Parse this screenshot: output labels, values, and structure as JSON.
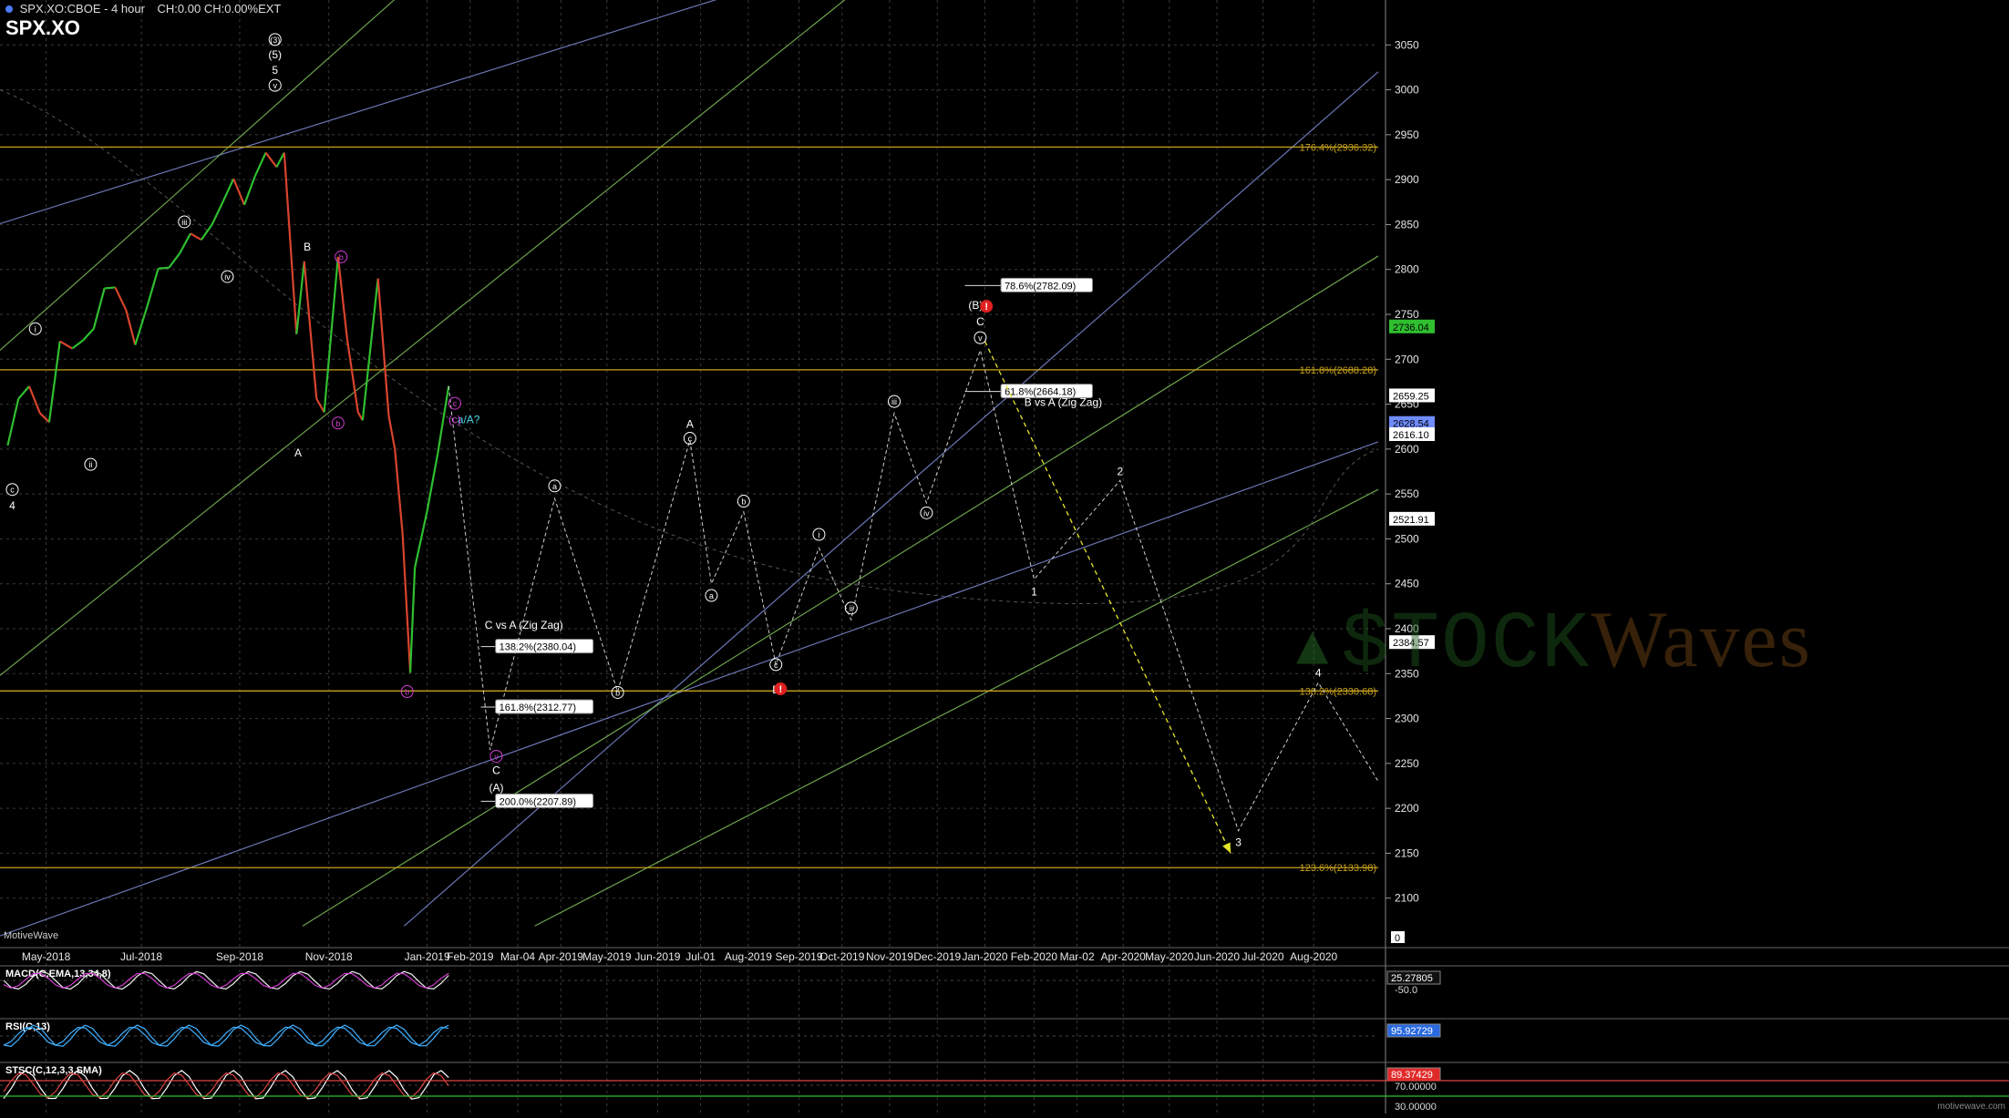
{
  "header": {
    "title": "SPX.XO:CBOE - 4 hour",
    "stats": "CH:0.00 CH:0.00%EXT",
    "symbol": "SPX.XO"
  },
  "brand": "MotiveWave",
  "watermark": {
    "part1": "$TOCK",
    "part2": "Waves"
  },
  "credit": "motivewave.com",
  "colors": {
    "grid": "#3a3a3a",
    "fib": "#c8a21a",
    "channel_blue": "#7f8cd6",
    "channel_green": "#7ebf5a",
    "projection": "#cfcfcf",
    "price_up": "#2fbf2f",
    "price_down": "#d9442c",
    "wave_magenta": "#d33bd3",
    "arrow_yellow": "#e6e62a"
  },
  "chart_data": {
    "type": "line",
    "title": "",
    "xlabel": "",
    "ylabel": "",
    "ylim": [
      2050,
      3100
    ],
    "x_ticks": [
      "May-2018",
      "Jul-2018",
      "Sep-2018",
      "Nov-2018",
      "Jan-2019",
      "Feb-2019",
      "Mar-04",
      "Apr-2019",
      "May-2019",
      "Jun-2019",
      "Jul-01",
      "Aug-2019",
      "Sep-2019",
      "Oct-2019",
      "Nov-2019",
      "Dec-2019",
      "Jan-2020",
      "Feb-2020",
      "Mar-02",
      "Apr-2020",
      "May-2020",
      "Jun-2020",
      "Jul-2020",
      "Aug-2020"
    ],
    "y_ticks": [
      2100,
      2150,
      2200,
      2250,
      2300,
      2350,
      2400,
      2450,
      2500,
      2550,
      2600,
      2650,
      2700,
      2750,
      2800,
      2850,
      2900,
      2950,
      3000,
      3050
    ],
    "grid": true,
    "series": [
      {
        "name": "SPX.XO",
        "kind": "price",
        "points": [
          [
            "2018-04-06",
            2604
          ],
          [
            "2018-04-13",
            2656
          ],
          [
            "2018-04-20",
            2670
          ],
          [
            "2018-04-27",
            2640
          ],
          [
            "2018-05-03",
            2630
          ],
          [
            "2018-05-10",
            2720
          ],
          [
            "2018-05-18",
            2712
          ],
          [
            "2018-05-25",
            2721
          ],
          [
            "2018-06-01",
            2734
          ],
          [
            "2018-06-08",
            2779
          ],
          [
            "2018-06-15",
            2780
          ],
          [
            "2018-06-22",
            2755
          ],
          [
            "2018-06-28",
            2716
          ],
          [
            "2018-07-06",
            2760
          ],
          [
            "2018-07-13",
            2801
          ],
          [
            "2018-07-20",
            2802
          ],
          [
            "2018-07-27",
            2818
          ],
          [
            "2018-08-03",
            2840
          ],
          [
            "2018-08-10",
            2833
          ],
          [
            "2018-08-17",
            2850
          ],
          [
            "2018-08-24",
            2875
          ],
          [
            "2018-08-31",
            2901
          ],
          [
            "2018-09-07",
            2872
          ],
          [
            "2018-09-14",
            2904
          ],
          [
            "2018-09-21",
            2930
          ],
          [
            "2018-09-28",
            2914
          ],
          [
            "2018-10-03",
            2930
          ],
          [
            "2018-10-11",
            2728
          ],
          [
            "2018-10-16",
            2809
          ],
          [
            "2018-10-24",
            2656
          ],
          [
            "2018-10-29",
            2641
          ],
          [
            "2018-11-07",
            2814
          ],
          [
            "2018-11-13",
            2722
          ],
          [
            "2018-11-20",
            2641
          ],
          [
            "2018-11-23",
            2632
          ],
          [
            "2018-12-03",
            2790
          ],
          [
            "2018-12-10",
            2637
          ],
          [
            "2018-12-14",
            2600
          ],
          [
            "2018-12-19",
            2506
          ],
          [
            "2018-12-24",
            2351
          ],
          [
            "2018-12-27",
            2468
          ],
          [
            "2019-01-04",
            2531
          ],
          [
            "2019-01-11",
            2596
          ],
          [
            "2019-01-18",
            2670
          ]
        ]
      },
      {
        "name": "",
        "kind": "projection",
        "points": [
          [
            "2019-01-18",
            2670
          ],
          [
            "2019-02-14",
            2265
          ],
          [
            "2019-03-28",
            2545
          ],
          [
            "2019-05-08",
            2330
          ],
          [
            "2019-06-24",
            2610
          ],
          [
            "2019-07-08",
            2450
          ],
          [
            "2019-07-29",
            2530
          ],
          [
            "2019-08-19",
            2360
          ],
          [
            "2019-09-16",
            2490
          ],
          [
            "2019-10-07",
            2410
          ],
          [
            "2019-11-04",
            2640
          ],
          [
            "2019-11-25",
            2540
          ],
          [
            "2019-12-30",
            2710
          ],
          [
            "2020-02-03",
            2455
          ],
          [
            "2020-03-30",
            2565
          ],
          [
            "2020-06-15",
            2175
          ],
          [
            "2020-08-06",
            2340
          ],
          [
            "2020-09-14",
            2230
          ]
        ]
      },
      {
        "name": "",
        "kind": "arrow",
        "points": [
          [
            "2020-01-02",
            2720
          ],
          [
            "2020-06-10",
            2150
          ]
        ]
      }
    ],
    "fib_levels": [
      {
        "label": "176.4%(2936.32)",
        "value": 2936.32
      },
      {
        "label": "161.8%(2688.28)",
        "value": 2688.28
      },
      {
        "label": "138.2%(2330.68)",
        "value": 2330.68
      },
      {
        "label": "123.6%(2133.98)",
        "value": 2133.98
      }
    ],
    "fib_boxes": [
      {
        "label": "78.6%(2782.09)",
        "value": 2782.09,
        "x": "2019-12-20",
        "x_end": "2020-03-12"
      },
      {
        "label": "61.8%(2664.18)",
        "value": 2664.18,
        "x": "2019-12-20",
        "x_end": "2020-03-12"
      },
      {
        "label": "138.2%(2380.04)",
        "value": 2380.04,
        "x": "2019-02-08",
        "x_end": "2019-04-22"
      },
      {
        "label": "161.8%(2312.77)",
        "value": 2312.77,
        "x": "2019-02-08",
        "x_end": "2019-04-22"
      },
      {
        "label": "200.0%(2207.89)",
        "value": 2207.89,
        "x": "2019-02-08",
        "x_end": "2019-04-22"
      }
    ],
    "annotations": [
      {
        "text": "C vs A (Zig Zag)",
        "x": "2019-03-08",
        "y": 2400
      },
      {
        "text": "B vs A (Zig Zag)",
        "x": "2020-02-22",
        "y": 2648
      },
      {
        "text": "a/A?",
        "x": "2019-01-31",
        "y": 2629
      }
    ],
    "price_tags": [
      {
        "label": "2736.04",
        "value": 2736.04,
        "color": "#2fbf2f"
      },
      {
        "label": "2659.25",
        "value": 2659.25,
        "color": "#ffffff"
      },
      {
        "label": "2628.54",
        "value": 2628.54,
        "color": "#6f8cff"
      },
      {
        "label": "2616.10",
        "value": 2616.1,
        "color": "#ffffff"
      },
      {
        "label": "2521.91",
        "value": 2521.91,
        "color": "#ffffff"
      },
      {
        "label": "2384.57",
        "value": 2384.57,
        "color": "#ffffff"
      }
    ],
    "wave_labels": [
      {
        "text": "(3)",
        "x": "2018-09-27",
        "y": 3056,
        "style": "circle-white"
      },
      {
        "text": "(5)",
        "x": "2018-09-27",
        "y": 3039,
        "style": "plain"
      },
      {
        "text": "5",
        "x": "2018-09-27",
        "y": 3022,
        "style": "plain"
      },
      {
        "text": "v",
        "x": "2018-09-27",
        "y": 3005,
        "style": "circle-white"
      },
      {
        "text": "iii",
        "x": "2018-07-30",
        "y": 2853,
        "style": "circle-white"
      },
      {
        "text": "iv",
        "x": "2018-08-27",
        "y": 2792,
        "style": "circle-white"
      },
      {
        "text": "i",
        "x": "2018-04-24",
        "y": 2734,
        "style": "circle-white"
      },
      {
        "text": "ii",
        "x": "2018-05-30",
        "y": 2583,
        "style": "circle-white"
      },
      {
        "text": "c",
        "x": "2018-04-09",
        "y": 2555,
        "style": "circle-white"
      },
      {
        "text": "4",
        "x": "2018-04-09",
        "y": 2537,
        "style": "plain"
      },
      {
        "text": "B",
        "x": "2018-10-18",
        "y": 2825,
        "style": "plain"
      },
      {
        "text": "A",
        "x": "2018-10-12",
        "y": 2596,
        "style": "plain"
      },
      {
        "text": "b",
        "x": "2018-11-09",
        "y": 2814,
        "style": "circle-magenta"
      },
      {
        "text": "b",
        "x": "2018-11-07",
        "y": 2629,
        "style": "circle-magenta"
      },
      {
        "text": "c",
        "x": "2019-01-22",
        "y": 2651,
        "style": "circle-magenta"
      },
      {
        "text": "(c)",
        "x": "2019-01-22",
        "y": 2633,
        "style": "magenta"
      },
      {
        "text": "b",
        "x": "2018-12-22",
        "y": 2330,
        "style": "circle-magenta"
      },
      {
        "text": "v",
        "x": "2019-02-18",
        "y": 2258,
        "style": "circle-magenta"
      },
      {
        "text": "C",
        "x": "2019-02-18",
        "y": 2242,
        "style": "plain"
      },
      {
        "text": "(A)",
        "x": "2019-02-18",
        "y": 2223,
        "style": "plain"
      },
      {
        "text": "a",
        "x": "2019-03-28",
        "y": 2559,
        "style": "circle-white"
      },
      {
        "text": "b",
        "x": "2019-05-08",
        "y": 2329,
        "style": "circle-white"
      },
      {
        "text": "A",
        "x": "2019-06-24",
        "y": 2628,
        "style": "plain"
      },
      {
        "text": "c",
        "x": "2019-06-24",
        "y": 2612,
        "style": "circle-white"
      },
      {
        "text": "a",
        "x": "2019-07-08",
        "y": 2437,
        "style": "circle-white"
      },
      {
        "text": "b",
        "x": "2019-07-29",
        "y": 2542,
        "style": "circle-white"
      },
      {
        "text": "c",
        "x": "2019-08-19",
        "y": 2360,
        "style": "circle-white"
      },
      {
        "text": "B",
        "x": "2019-08-19",
        "y": 2332,
        "style": "plain"
      },
      {
        "text": "!",
        "x": "2019-08-22",
        "y": 2333,
        "style": "alert"
      },
      {
        "text": "i",
        "x": "2019-09-16",
        "y": 2505,
        "style": "circle-white"
      },
      {
        "text": "ii",
        "x": "2019-10-07",
        "y": 2423,
        "style": "circle-white"
      },
      {
        "text": "iii",
        "x": "2019-11-04",
        "y": 2653,
        "style": "circle-white"
      },
      {
        "text": "iv",
        "x": "2019-11-25",
        "y": 2529,
        "style": "circle-white"
      },
      {
        "text": "(B)",
        "x": "2019-12-27",
        "y": 2760,
        "style": "plain"
      },
      {
        "text": "!",
        "x": "2020-01-03",
        "y": 2759,
        "style": "alert"
      },
      {
        "text": "C",
        "x": "2019-12-30",
        "y": 2742,
        "style": "plain"
      },
      {
        "text": "v",
        "x": "2019-12-30",
        "y": 2724,
        "style": "circle-white"
      },
      {
        "text": "1",
        "x": "2020-02-03",
        "y": 2441,
        "style": "plain"
      },
      {
        "text": "2",
        "x": "2020-03-30",
        "y": 2575,
        "style": "plain"
      },
      {
        "text": "3",
        "x": "2020-06-15",
        "y": 2162,
        "style": "plain"
      },
      {
        "text": "4",
        "x": "2020-08-06",
        "y": 2351,
        "style": "plain"
      }
    ],
    "trend_channels": [
      {
        "color": "#7f8cd6",
        "from": [
          "2018-04-01",
          2058
        ],
        "to": [
          "2020-09-14",
          2608
        ]
      },
      {
        "color": "#7f8cd6",
        "from": [
          "2018-04-01",
          2851
        ],
        "to": [
          "2019-07-29",
          3110
        ]
      },
      {
        "color": "#7f8cd6",
        "from": [
          "2018-12-20",
          2069
        ],
        "to": [
          "2020-09-14",
          3020
        ]
      },
      {
        "color": "#7ebf5a",
        "from": [
          "2018-04-01",
          2348
        ],
        "to": [
          "2019-10-10",
          3110
        ]
      },
      {
        "color": "#7ebf5a",
        "from": [
          "2018-04-01",
          2710
        ],
        "to": [
          "2018-12-20",
          3110
        ]
      },
      {
        "color": "#7ebf5a",
        "from": [
          "2018-10-15",
          2069
        ],
        "to": [
          "2020-09-14",
          2815
        ]
      },
      {
        "color": "#7ebf5a",
        "from": [
          "2019-03-15",
          2069
        ],
        "to": [
          "2020-09-14",
          2555
        ]
      }
    ],
    "indicators": [
      {
        "name": "MACD(C,EMA,13,34,8)",
        "value": "25.27805",
        "value2": "-50.0"
      },
      {
        "name": "RSI(C,13)",
        "value": "95.92729"
      },
      {
        "name": "STSC(C,12,3,3,SMA)",
        "value": "89.37429",
        "value2": "70.00000",
        "value3": "30.00000"
      }
    ],
    "zero_tag": "0"
  }
}
